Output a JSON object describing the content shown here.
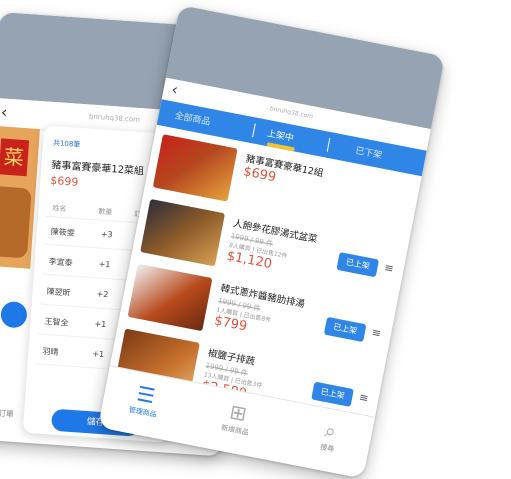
{
  "left_phone": {
    "url": "bnruhq38.com",
    "count_label": "共108筆",
    "product_title": "豬事富賽豪華12菜組",
    "price": "$699",
    "columns": [
      "姓名",
      "數量",
      "訂貨",
      "取貨"
    ],
    "rows": [
      {
        "name": "陳筱雯",
        "qty": "+3"
      },
      {
        "name": "李宜泰",
        "qty": "+1"
      },
      {
        "name": "陳翌昕",
        "qty": "+2"
      },
      {
        "name": "王智全",
        "qty": "+1"
      },
      {
        "name": "羽晴",
        "qty": "+1"
      }
    ],
    "save_label": "儲存",
    "edge_label": "訂單"
  },
  "right_phone": {
    "url": "bnruhq38.com",
    "tabs": [
      "全部商品",
      "上架中",
      "已下架"
    ],
    "active_tab": "上架中",
    "items": [
      {
        "name": "豬事富賽豪華12組",
        "price": "$699",
        "original": "",
        "meta": "",
        "action": ""
      },
      {
        "name": "人飽參花膠湯式盆菜",
        "price": "$1,120",
        "original": "1999 / 99 件",
        "meta": "8人購買 | 已出售12件",
        "action": "已上架"
      },
      {
        "name": "韓式蔥炸醬豬肋排湯",
        "price": "$799",
        "original": "1999 / 99 件",
        "meta": "1人購買 | 已出售8件",
        "action": "已上架"
      },
      {
        "name": "椒鹽子排蔬",
        "price": "$2,580",
        "original": "1999 / 99 件",
        "meta": "13人購買 | 已出售3件",
        "action": "已上架"
      }
    ],
    "nav": [
      {
        "label": "管理商品",
        "icon": "list-icon"
      },
      {
        "label": "新增商品",
        "icon": "plus-icon"
      },
      {
        "label": "搜尋",
        "icon": "search-icon"
      }
    ]
  },
  "colors": {
    "accent": "#1f78e8",
    "price": "#e0533d",
    "check": "#2aa84a",
    "header_band": "#95a3b3"
  }
}
